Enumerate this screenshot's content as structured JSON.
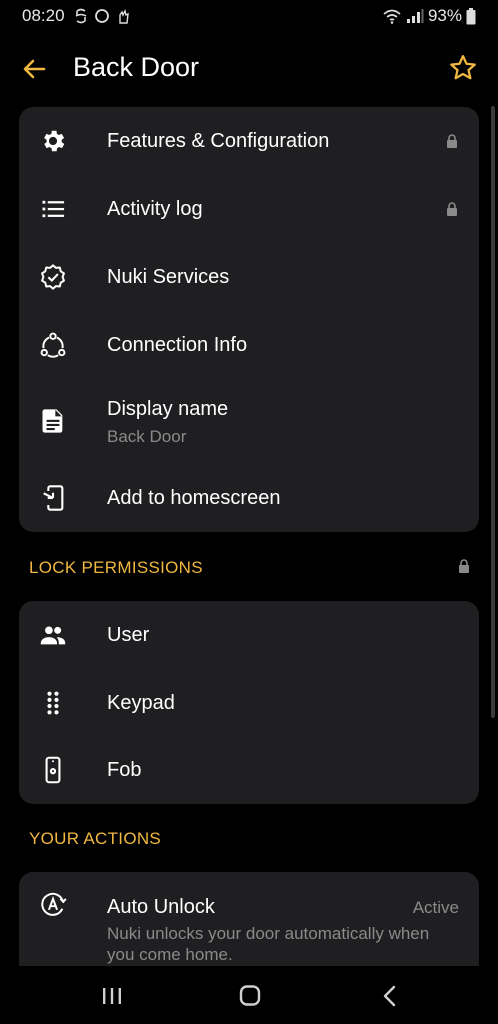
{
  "status_bar": {
    "time": "08:20",
    "battery": "93%"
  },
  "app_bar": {
    "title": "Back Door"
  },
  "menu": [
    {
      "label": "Features & Configuration",
      "icon": "gear-icon",
      "locked": true
    },
    {
      "label": "Activity log",
      "icon": "list-icon",
      "locked": true
    },
    {
      "label": "Nuki Services",
      "icon": "verified-badge-icon",
      "locked": false
    },
    {
      "label": "Connection Info",
      "icon": "connection-nodes-icon",
      "locked": false
    },
    {
      "label": "Display name",
      "sublabel": "Back Door",
      "icon": "document-icon",
      "locked": false
    },
    {
      "label": "Add to homescreen",
      "icon": "add-to-homescreen-icon",
      "locked": false
    }
  ],
  "lock_permissions": {
    "header": "LOCK PERMISSIONS",
    "items": [
      {
        "label": "User",
        "icon": "people-icon"
      },
      {
        "label": "Keypad",
        "icon": "keypad-icon"
      },
      {
        "label": "Fob",
        "icon": "fob-icon"
      }
    ]
  },
  "your_actions": {
    "header": "YOUR ACTIONS",
    "items": [
      {
        "label": "Auto Unlock",
        "status": "Active",
        "description": "Nuki unlocks your door automatically when you come home.",
        "icon": "auto-unlock-icon"
      }
    ]
  },
  "colors": {
    "accent": "#f0b840",
    "card_bg": "#1f1f21",
    "secondary_text": "#8a8a8a"
  }
}
